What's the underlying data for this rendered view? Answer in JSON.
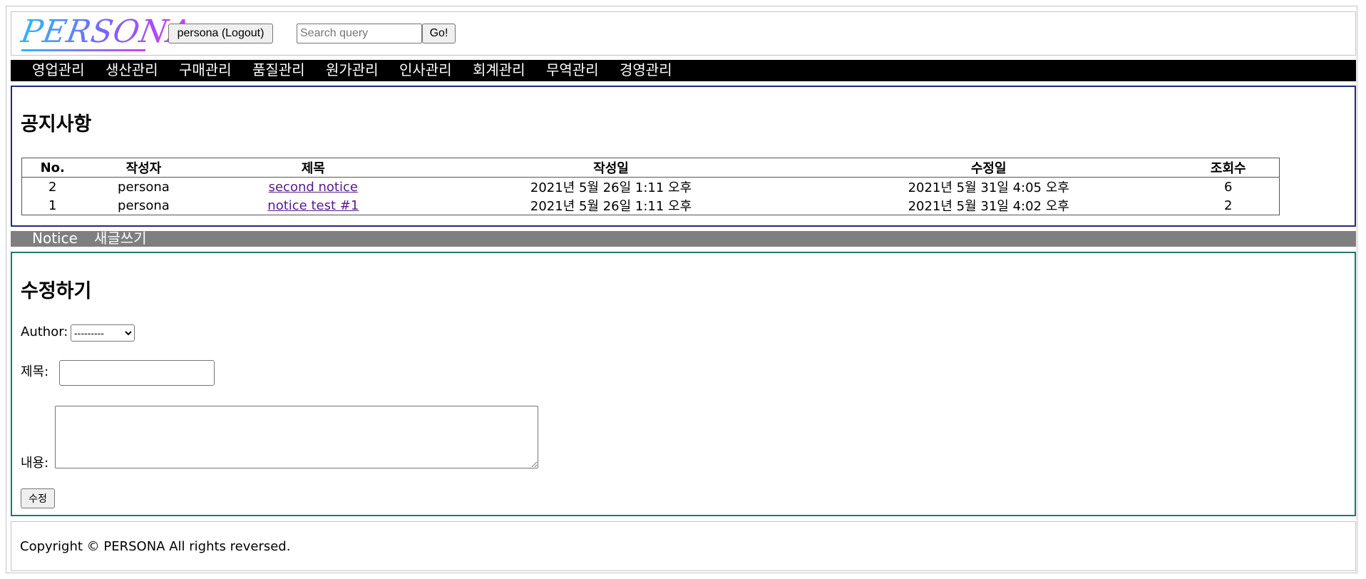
{
  "header": {
    "logo_text": "PERSONA",
    "logout_label": "persona (Logout)",
    "search": {
      "placeholder": "Search query",
      "value": ""
    },
    "go_label": "Go!"
  },
  "topnav": {
    "items": [
      "영업관리",
      "생산관리",
      "구매관리",
      "품질관리",
      "원가관리",
      "인사관리",
      "회계관리",
      "무역관리",
      "경영관리"
    ]
  },
  "notice": {
    "title": "공지사항",
    "columns": [
      "No.",
      "작성자",
      "제목",
      "작성일",
      "수정일",
      "조회수"
    ],
    "rows": [
      {
        "no": "2",
        "author": "persona",
        "title": "second notice",
        "created": "2021년 5월 26일 1:11 오후",
        "modified": "2021년 5월 31일 4:05 오후",
        "views": "6"
      },
      {
        "no": "1",
        "author": "persona",
        "title": "notice test #1",
        "created": "2021년 5월 26일 1:11 오후",
        "modified": "2021년 5월 31일 4:02 오후",
        "views": "2"
      }
    ]
  },
  "subnav": {
    "items": [
      "Notice",
      "새글쓰기"
    ]
  },
  "edit_form": {
    "title": "수정하기",
    "author_label": "Author:",
    "author_selected": "---------",
    "title_label": "제목:",
    "title_value": "",
    "content_label": "내용:",
    "content_value": "",
    "submit_label": "수정"
  },
  "footer": {
    "copyright": "Copyright © PERSONA All rights reversed."
  },
  "colors": {
    "nav_bg": "#000000",
    "subnav_bg": "#7f7f7f",
    "notice_border": "#1f2a7a",
    "edit_border": "#1f7a6a",
    "link": "#551a8b"
  }
}
